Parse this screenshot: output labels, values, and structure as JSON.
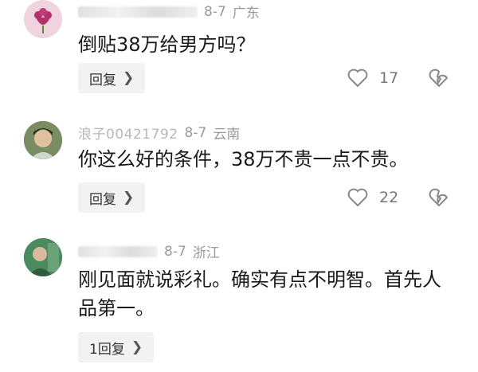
{
  "comments": [
    {
      "date": "8-7",
      "location": "广东",
      "text": "倒贴38万给男方吗？",
      "reply_label": "回复",
      "like_count": "17"
    },
    {
      "username": "浪子00421792",
      "date": "8-7",
      "location": "云南",
      "text": "你这么好的条件，38万不贵一点不贵。",
      "reply_label": "回复",
      "like_count": "22"
    },
    {
      "date": "8-7",
      "location": "浙江",
      "text": "刚见面就说彩礼。确实有点不明智。首先人品第一。",
      "reply_label": "1回复"
    }
  ],
  "icons": {
    "heart": "heart-icon",
    "broken_heart": "broken-heart-icon",
    "chevron": "chevron-right-icon"
  },
  "colors": {
    "text": "#1a1a1a",
    "meta": "#9a9a9a",
    "button_bg": "#f2f2f2"
  }
}
